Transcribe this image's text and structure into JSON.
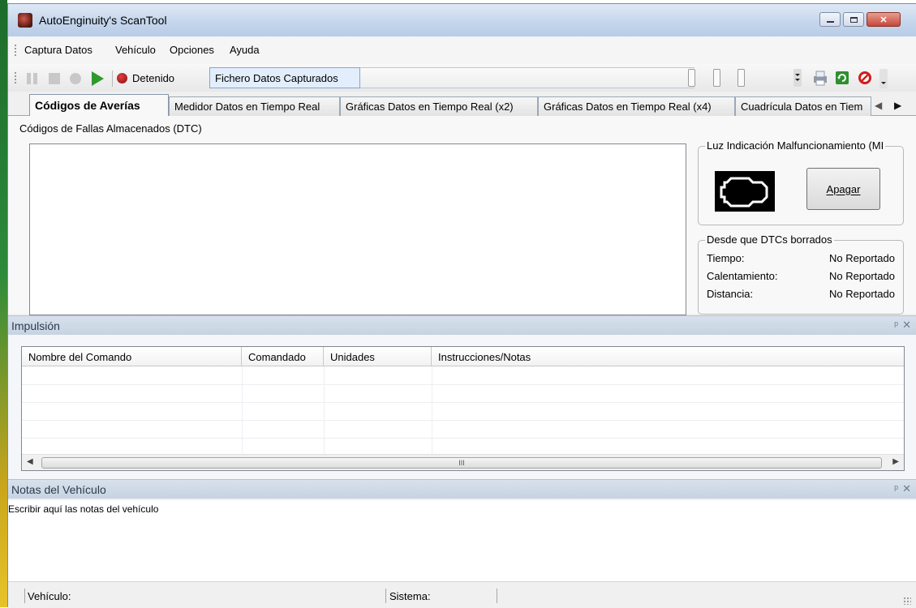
{
  "window": {
    "title": "AutoEnginuity's ScanTool"
  },
  "menu": [
    {
      "label": "Captura Datos"
    },
    {
      "label": "Vehículo"
    },
    {
      "label": "Opciones"
    },
    {
      "label": "Ayuda"
    }
  ],
  "toolbar": {
    "status_label": "Detenido",
    "capture_file_label": "Fichero Datos Capturados"
  },
  "tabs": [
    {
      "label": "Códigos de Averías",
      "active": true
    },
    {
      "label": "Medidor Datos en Tiempo Real"
    },
    {
      "label": "Gráficas Datos en Tiempo Real (x2)"
    },
    {
      "label": "Gráficas Datos en Tiempo Real (x4)"
    },
    {
      "label": "Cuadrícula Datos en Tiem"
    }
  ],
  "dtc": {
    "label": "Códigos de Fallas Almacenados (DTC)",
    "mil_group_title": "Luz Indicación Malfuncionamiento (MI",
    "mil_button": "Apagar",
    "since_group_title": "Desde que DTCs borrados",
    "since_rows": [
      {
        "key": "Tiempo:",
        "value": "No Reportado"
      },
      {
        "key": "Calentamiento:",
        "value": "No Reportado"
      },
      {
        "key": "Distancia:",
        "value": "No Reportado"
      }
    ]
  },
  "impulsion": {
    "title": "Impulsión",
    "pin_glyph": "ᵖ",
    "close_glyph": "✕",
    "columns": [
      "Nombre del Comando",
      "Comandado",
      "Unidades",
      "Instrucciones/Notas"
    ],
    "scroll_thumb_glyph": "III"
  },
  "notes": {
    "title": "Notas del Vehículo",
    "text": "Escribir aquí las notas del vehículo"
  },
  "statusbar": {
    "vehicle_label": "Vehículo:",
    "system_label": "Sistema:"
  },
  "icons": {
    "pause": "pause-icon",
    "stop": "stop-icon",
    "record": "record-icon",
    "play": "play-icon",
    "print": "printer-icon",
    "refresh": "refresh-icon",
    "cancel": "no-entry-icon"
  },
  "colors": {
    "play": "#2e9a2e",
    "stop_dot": "#b01515",
    "header_blue": "#c9d6e6",
    "cancel_red": "#d21c1c"
  }
}
